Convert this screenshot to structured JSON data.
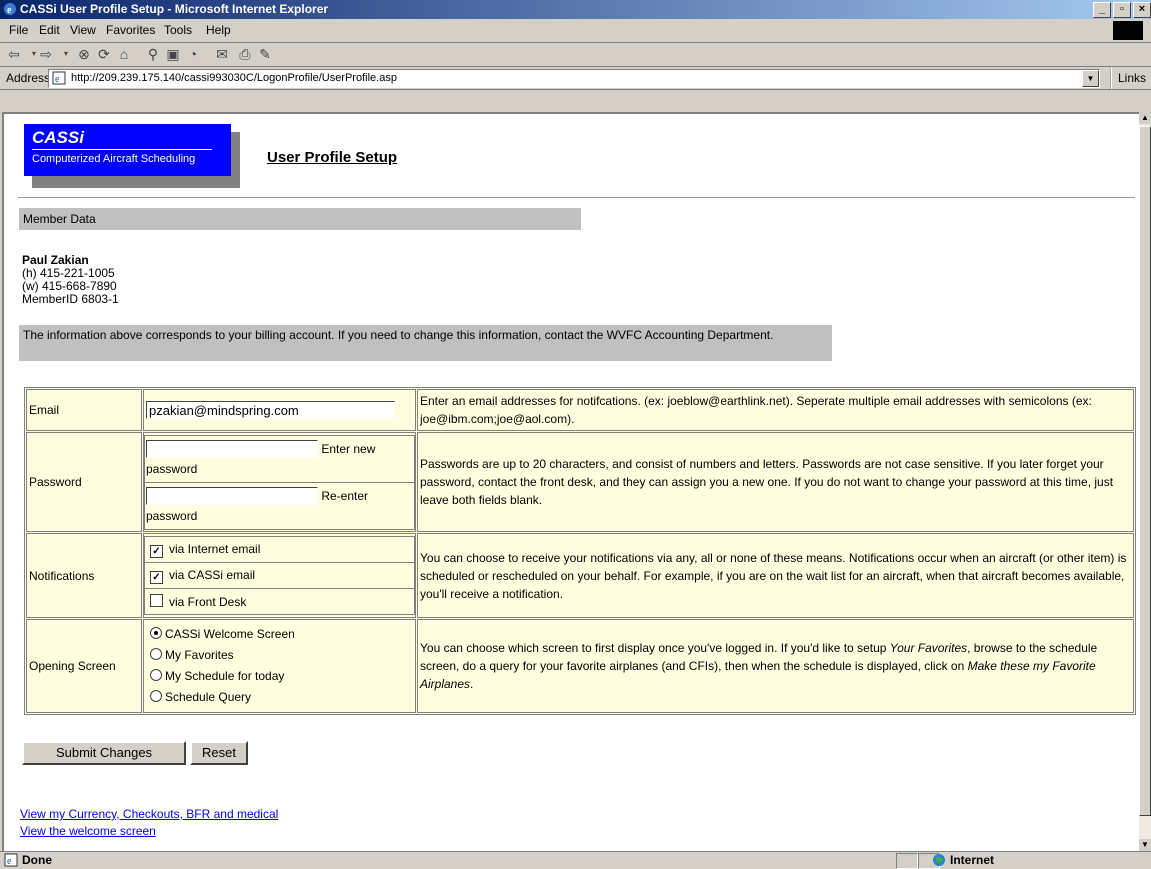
{
  "window": {
    "title": "CASSi User Profile Setup - Microsoft Internet Explorer"
  },
  "menu": {
    "file": "File",
    "edit": "Edit",
    "view": "View",
    "favorites": "Favorites",
    "tools": "Tools",
    "help": "Help"
  },
  "address": {
    "label": "Address",
    "url": "http://209.239.175.140/cassi993030C/LogonProfile/UserProfile.asp",
    "links": "Links"
  },
  "status": {
    "text": "Done",
    "zone": "Internet"
  },
  "page": {
    "logo_title": "CASSi",
    "logo_subtitle": "Computerized Aircraft Scheduling",
    "title": "User Profile Setup",
    "section": "Member Data",
    "member_name": "Paul Zakian",
    "home_phone": "(h) 415-221-1005",
    "work_phone": "(w) 415-668-7890",
    "member_id": "MemberID 6803-1",
    "billing_note": "The information above corresponds to your billing account.  If you need to change this information, contact the WVFC Accounting Department."
  },
  "form": {
    "email": {
      "label": "Email",
      "value": "pzakian@mindspring.com",
      "help": "Enter an email addresses for notifcations.  (ex: joeblow@earthlink.net).  Seperate multiple email addresses with semicolons (ex: joe@ibm.com;joe@aol.com)."
    },
    "password": {
      "label": "Password",
      "new_label": "Enter new password",
      "reenter_label": "Re-enter password",
      "help": "Passwords are up to 20 characters, and consist of numbers and letters.  Passwords are not case sensitive.  If you later forget your password, contact the front desk, and they can assign you a new one.  If you do not want to change your password at this time, just leave both fields blank."
    },
    "notifications": {
      "label": "Notifications",
      "internet": "via Internet email",
      "cassi": "via CASSi email",
      "front_desk": "via Front Desk",
      "help": "You can choose to receive your notifications via any, all or none of these means.  Notifications occur when an aircraft (or other item) is scheduled or rescheduled on your behalf.  For example, if you are on the wait list for an aircraft, when that aircraft becomes available, you'll receive a notification."
    },
    "opening": {
      "label": "Opening Screen",
      "opt1": "CASSi Welcome Screen",
      "opt2": "My Favorites",
      "opt3": "My Schedule for today",
      "opt4": "Schedule Query",
      "help_a": "You can choose which screen to first display once you've logged in. If you'd like to setup ",
      "help_b": "Your Favorites",
      "help_c": ", browse to the schedule screen, do a query for your favorite airplanes (and CFIs), then when the schedule is displayed, click on ",
      "help_d": "Make these my Favorite Airplanes",
      "help_e": "."
    },
    "submit": "Submit Changes",
    "reset": "Reset"
  },
  "links": {
    "currency": "View my Currency, Checkouts, BFR and medical",
    "welcome": "View the welcome screen"
  }
}
